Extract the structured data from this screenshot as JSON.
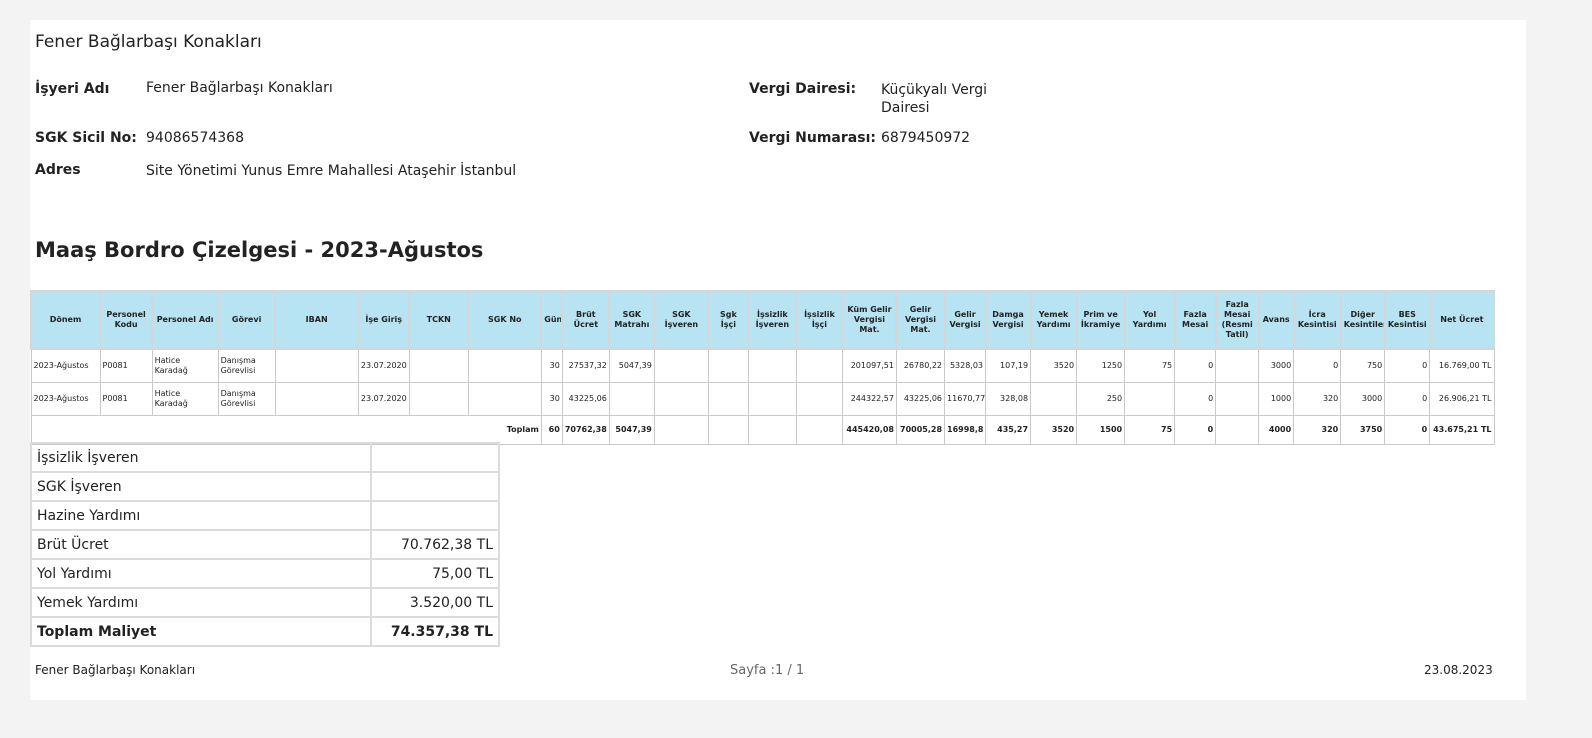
{
  "company": {
    "title": "Fener Bağlarbaşı Konakları"
  },
  "info": {
    "isyeri_label": "İşyeri Adı",
    "isyeri_value": "Fener Bağlarbaşı Konakları",
    "sgk_label": "SGK Sicil No:",
    "sgk_value": "94086574368",
    "adres_label": "Adres",
    "adres_value": "Site Yönetimi Yunus Emre Mahallesi  Ataşehir İstanbul",
    "vergi_dairesi_label": "Vergi Dairesi:",
    "vergi_dairesi_value_line1": "Küçükyalı Vergi",
    "vergi_dairesi_value_line2": "Dairesi",
    "vergi_no_label": "Vergi Numarası:",
    "vergi_no_value": "6879450972"
  },
  "report_title": "Maaş Bordro Çizelgesi - 2023-Ağustos",
  "table": {
    "headers": [
      "Dönem",
      "Personel Kodu",
      "Personel Adı",
      "Görevi",
      "IBAN",
      "İşe Giriş",
      "TCKN",
      "SGK No",
      "Gün",
      "Brüt Ücret",
      "SGK Matrahı",
      "SGK İşveren",
      "Sgk İşçi",
      "İşsizlik İşveren",
      "İşsizlik İşçi",
      "Küm Gelir Vergisi Mat.",
      "Gelir Vergisi Mat.",
      "Gelir Vergisi",
      "Damga Vergisi",
      "Yemek Yardımı",
      "Prim ve İkramiye",
      "Yol Yardımı",
      "Fazla Mesai",
      "Fazla Mesai (Resmi Tatil)",
      "Avans",
      "İcra Kesintisi",
      "Diğer Kesintiler",
      "BES Kesintisi",
      "Net Ücret"
    ],
    "rows": [
      [
        "2023-Ağustos",
        "P0081",
        "Hatice Karadağ",
        "Danışma Görevlisi",
        "",
        "23.07.2020",
        "",
        "",
        "30",
        "27537,32",
        "5047,39",
        "",
        "",
        "",
        "",
        "201097,51",
        "26780,22",
        "5328,03",
        "107,19",
        "3520",
        "1250",
        "75",
        "0",
        "",
        "3000",
        "0",
        "750",
        "0",
        "16.769,00 TL"
      ],
      [
        "2023-Ağustos",
        "P0081",
        "Hatice Karadağ",
        "Danışma Görevlisi",
        "",
        "23.07.2020",
        "",
        "",
        "30",
        "43225,06",
        "",
        "",
        "",
        "",
        "",
        "244322,57",
        "43225,06",
        "11670,77",
        "328,08",
        "",
        "250",
        "",
        "0",
        "",
        "1000",
        "320",
        "3000",
        "0",
        "26.906,21 TL"
      ]
    ],
    "total_label": "Toplam",
    "totals": [
      "60",
      "70762,38",
      "5047,39",
      "",
      "",
      "",
      "",
      "445420,08",
      "70005,28",
      "16998,8",
      "435,27",
      "3520",
      "1500",
      "75",
      "0",
      "",
      "4000",
      "320",
      "3750",
      "0",
      "43.675,21 TL"
    ]
  },
  "summary": [
    {
      "label": "İşsizlik İşveren",
      "value": ""
    },
    {
      "label": "SGK İşveren",
      "value": ""
    },
    {
      "label": "Hazine Yardımı",
      "value": ""
    },
    {
      "label": "Brüt Ücret",
      "value": "70.762,38 TL"
    },
    {
      "label": "Yol Yardımı",
      "value": "75,00 TL"
    },
    {
      "label": "Yemek Yardımı",
      "value": "3.520,00 TL"
    },
    {
      "label": "Toplam Maliyet",
      "value": "74.357,38 TL"
    }
  ],
  "footer": {
    "company": "Fener Bağlarbaşı Konakları",
    "page": "Sayfa :1 / 1",
    "date": "23.08.2023"
  }
}
